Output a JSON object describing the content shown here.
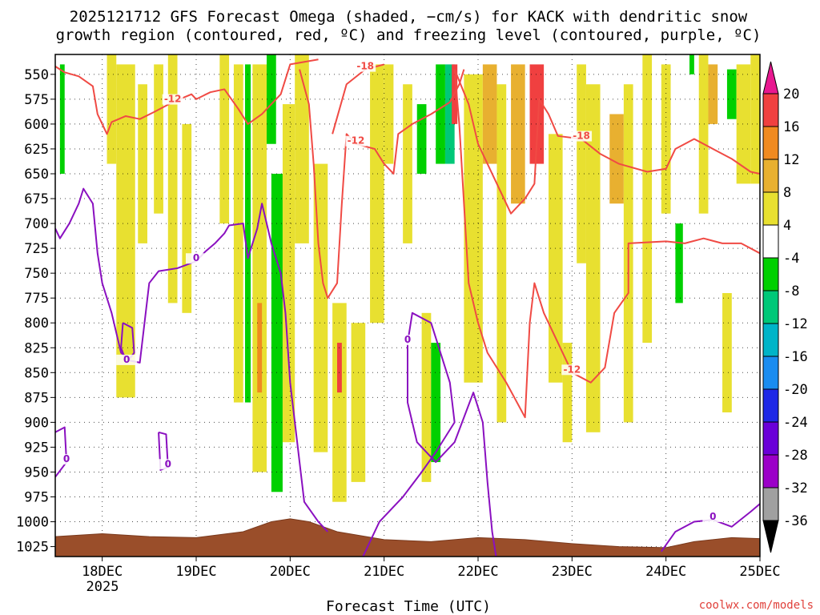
{
  "chart_data": {
    "type": "heatmap",
    "title_line1": "2025121712 GFS Forecast Omega (shaded, −cm/s) for KACK with dendritic snow",
    "title_line2": "growth region (contoured, red, ºC) and freezing level (contoured, purple, ºC)",
    "xlabel": "Forecast Time (UTC)",
    "ylabel": "",
    "credit": "coolwx.com/models",
    "x_ticks": [
      "18DEC",
      "19DEC",
      "20DEC",
      "21DEC",
      "22DEC",
      "23DEC",
      "24DEC",
      "25DEC"
    ],
    "x_year_label": "2025",
    "x_range": [
      -0.5,
      7.0
    ],
    "y_ticks": [
      550,
      575,
      600,
      625,
      650,
      675,
      700,
      725,
      750,
      775,
      800,
      825,
      850,
      875,
      900,
      925,
      950,
      975,
      1000,
      1025
    ],
    "y_range": [
      530,
      1035
    ],
    "colorbar": {
      "boundaries": [
        -36,
        -32,
        -28,
        -24,
        -20,
        -16,
        -12,
        -8,
        -4,
        4,
        8,
        12,
        16,
        20
      ],
      "colors": [
        "#000000",
        "#a0a0a0",
        "#9b00c8",
        "#6a00d8",
        "#1e28e6",
        "#1a8cf0",
        "#00b4c8",
        "#00c878",
        "#00d000",
        "#ffffff",
        "#e8e030",
        "#e8b030",
        "#f08a20",
        "#f04040",
        "#e81890"
      ]
    },
    "dgz_contours": [
      {
        "label": "-12",
        "points": [
          [
            -0.5,
            542
          ],
          [
            -0.4,
            548
          ],
          [
            -0.25,
            552
          ],
          [
            -0.1,
            562
          ],
          [
            -0.05,
            590
          ],
          [
            0.05,
            610
          ],
          [
            0.1,
            598
          ],
          [
            0.25,
            592
          ],
          [
            0.4,
            595
          ],
          [
            0.55,
            588
          ],
          [
            0.75,
            578
          ],
          [
            0.95,
            570
          ],
          [
            1.0,
            575
          ],
          [
            1.15,
            568
          ],
          [
            1.3,
            565
          ],
          [
            1.45,
            585
          ],
          [
            1.55,
            600
          ],
          [
            1.7,
            590
          ],
          [
            1.9,
            570
          ],
          [
            2.0,
            540
          ],
          [
            2.3,
            535
          ]
        ]
      },
      {
        "label": "-12",
        "points": [
          [
            2.1,
            545
          ],
          [
            2.2,
            580
          ],
          [
            2.25,
            640
          ],
          [
            2.3,
            720
          ],
          [
            2.35,
            760
          ],
          [
            2.4,
            775
          ],
          [
            2.5,
            760
          ],
          [
            2.55,
            680
          ],
          [
            2.6,
            610
          ],
          [
            2.7,
            620
          ],
          [
            2.9,
            625
          ],
          [
            3.0,
            640
          ],
          [
            3.1,
            650
          ],
          [
            3.15,
            610
          ],
          [
            3.3,
            600
          ],
          [
            3.5,
            590
          ],
          [
            3.7,
            578
          ],
          [
            3.8,
            560
          ],
          [
            3.85,
            545
          ]
        ]
      },
      {
        "label": "-12",
        "points": [
          [
            3.75,
            545
          ],
          [
            3.8,
            600
          ],
          [
            3.85,
            680
          ],
          [
            3.9,
            760
          ],
          [
            4.0,
            800
          ],
          [
            4.1,
            830
          ],
          [
            4.3,
            860
          ],
          [
            4.5,
            895
          ],
          [
            4.55,
            800
          ],
          [
            4.6,
            760
          ],
          [
            4.7,
            790
          ],
          [
            4.9,
            830
          ],
          [
            5.0,
            850
          ],
          [
            5.2,
            860
          ],
          [
            5.35,
            845
          ],
          [
            5.45,
            790
          ],
          [
            5.6,
            770
          ],
          [
            5.6,
            720
          ],
          [
            6.0,
            718
          ],
          [
            6.2,
            720
          ],
          [
            6.4,
            715
          ],
          [
            6.6,
            720
          ],
          [
            6.8,
            720
          ],
          [
            7.0,
            730
          ]
        ]
      },
      {
        "label": "-18",
        "points": [
          [
            3.75,
            545
          ],
          [
            3.9,
            580
          ],
          [
            4.0,
            620
          ],
          [
            4.2,
            660
          ],
          [
            4.35,
            690
          ],
          [
            4.5,
            675
          ],
          [
            4.6,
            660
          ],
          [
            4.65,
            575
          ],
          [
            4.75,
            590
          ],
          [
            4.85,
            612
          ],
          [
            5.1,
            615
          ],
          [
            5.3,
            630
          ],
          [
            5.5,
            640
          ],
          [
            5.8,
            648
          ],
          [
            6.0,
            645
          ],
          [
            6.1,
            625
          ],
          [
            6.3,
            615
          ],
          [
            6.5,
            625
          ],
          [
            6.7,
            635
          ],
          [
            6.9,
            648
          ],
          [
            7.0,
            650
          ]
        ]
      },
      {
        "label": "-18",
        "points": [
          [
            2.45,
            610
          ],
          [
            2.6,
            560
          ],
          [
            2.8,
            545
          ],
          [
            3.0,
            540
          ]
        ]
      }
    ],
    "freezing_contours": [
      {
        "label": "0",
        "points": [
          [
            -0.5,
            705
          ],
          [
            -0.45,
            715
          ],
          [
            -0.35,
            700
          ],
          [
            -0.25,
            680
          ],
          [
            -0.2,
            665
          ],
          [
            -0.1,
            680
          ],
          [
            -0.05,
            730
          ],
          [
            0.0,
            760
          ],
          [
            0.1,
            790
          ],
          [
            0.2,
            830
          ],
          [
            0.3,
            838
          ],
          [
            0.4,
            840
          ],
          [
            0.45,
            800
          ],
          [
            0.5,
            760
          ],
          [
            0.6,
            748
          ],
          [
            0.8,
            745
          ],
          [
            1.0,
            738
          ],
          [
            1.1,
            728
          ],
          [
            1.2,
            720
          ],
          [
            1.3,
            710
          ],
          [
            1.35,
            702
          ],
          [
            1.5,
            700
          ],
          [
            1.55,
            735
          ],
          [
            1.65,
            705
          ],
          [
            1.7,
            680
          ],
          [
            1.8,
            720
          ],
          [
            1.9,
            750
          ],
          [
            1.95,
            790
          ],
          [
            2.0,
            860
          ],
          [
            2.1,
            940
          ],
          [
            2.15,
            980
          ],
          [
            2.3,
            1000
          ],
          [
            2.4,
            1010
          ]
        ]
      },
      {
        "label": "0",
        "points": [
          [
            2.75,
            1040
          ],
          [
            2.95,
            1000
          ],
          [
            3.2,
            975
          ],
          [
            3.4,
            950
          ],
          [
            3.55,
            930
          ],
          [
            3.75,
            900
          ],
          [
            3.7,
            860
          ],
          [
            3.5,
            800
          ],
          [
            3.3,
            790
          ],
          [
            3.25,
            820
          ],
          [
            3.25,
            880
          ],
          [
            3.35,
            920
          ],
          [
            3.55,
            940
          ],
          [
            3.75,
            920
          ],
          [
            3.95,
            870
          ],
          [
            4.05,
            900
          ],
          [
            4.1,
            960
          ],
          [
            4.15,
            1010
          ],
          [
            4.2,
            1040
          ]
        ]
      },
      {
        "label": "0",
        "points": [
          [
            -0.5,
            910
          ],
          [
            -0.4,
            905
          ],
          [
            -0.38,
            940
          ],
          [
            -0.5,
            955
          ]
        ]
      },
      {
        "label": "0",
        "points": [
          [
            0.22,
            800
          ],
          [
            0.32,
            805
          ],
          [
            0.34,
            830
          ],
          [
            0.26,
            840
          ],
          [
            0.2,
            825
          ],
          [
            0.22,
            800
          ]
        ]
      },
      {
        "label": "0",
        "points": [
          [
            0.6,
            910
          ],
          [
            0.68,
            912
          ],
          [
            0.7,
            945
          ],
          [
            0.62,
            948
          ],
          [
            0.6,
            910
          ]
        ]
      },
      {
        "label": "0",
        "points": [
          [
            5.95,
            1030
          ],
          [
            6.1,
            1010
          ],
          [
            6.3,
            1000
          ],
          [
            6.5,
            998
          ],
          [
            6.7,
            1005
          ],
          [
            6.9,
            990
          ],
          [
            7.0,
            982
          ]
        ]
      }
    ],
    "omega_cells": [
      {
        "x": [
          -0.45,
          -0.4
        ],
        "p": [
          540,
          650
        ],
        "value": -6
      },
      {
        "x": [
          0.05,
          0.15
        ],
        "p": [
          530,
          640
        ],
        "value": 5
      },
      {
        "x": [
          0.15,
          0.35
        ],
        "p": [
          540,
          875
        ],
        "value": 6
      },
      {
        "x": [
          0.38,
          0.48
        ],
        "p": [
          560,
          720
        ],
        "value": 5
      },
      {
        "x": [
          0.55,
          0.65
        ],
        "p": [
          540,
          690
        ],
        "value": 5
      },
      {
        "x": [
          0.7,
          0.8
        ],
        "p": [
          530,
          780
        ],
        "value": 6
      },
      {
        "x": [
          0.85,
          0.95
        ],
        "p": [
          600,
          790
        ],
        "value": 5
      },
      {
        "x": [
          1.25,
          1.35
        ],
        "p": [
          530,
          700
        ],
        "value": 5
      },
      {
        "x": [
          1.4,
          1.5
        ],
        "p": [
          540,
          880
        ],
        "value": 6
      },
      {
        "x": [
          1.52,
          1.58
        ],
        "p": [
          540,
          880
        ],
        "value": -6
      },
      {
        "x": [
          1.6,
          1.75
        ],
        "p": [
          540,
          950
        ],
        "value": 7
      },
      {
        "x": [
          1.65,
          1.7
        ],
        "p": [
          780,
          870
        ],
        "value": 13
      },
      {
        "x": [
          1.75,
          1.85
        ],
        "p": [
          530,
          620
        ],
        "value": -6
      },
      {
        "x": [
          1.8,
          1.92
        ],
        "p": [
          650,
          970
        ],
        "value": -6
      },
      {
        "x": [
          1.92,
          2.05
        ],
        "p": [
          580,
          920
        ],
        "value": 6
      },
      {
        "x": [
          2.05,
          2.2
        ],
        "p": [
          530,
          720
        ],
        "value": 5
      },
      {
        "x": [
          2.25,
          2.4
        ],
        "p": [
          640,
          930
        ],
        "value": 6
      },
      {
        "x": [
          2.45,
          2.6
        ],
        "p": [
          780,
          980
        ],
        "value": 7
      },
      {
        "x": [
          2.5,
          2.55
        ],
        "p": [
          820,
          870
        ],
        "value": 17
      },
      {
        "x": [
          2.65,
          2.8
        ],
        "p": [
          800,
          960
        ],
        "value": 5
      },
      {
        "x": [
          2.85,
          3.0
        ],
        "p": [
          540,
          800
        ],
        "value": 5
      },
      {
        "x": [
          3.0,
          3.1
        ],
        "p": [
          540,
          640
        ],
        "value": 5
      },
      {
        "x": [
          3.2,
          3.3
        ],
        "p": [
          560,
          720
        ],
        "value": 5
      },
      {
        "x": [
          3.35,
          3.45
        ],
        "p": [
          580,
          650
        ],
        "value": -6
      },
      {
        "x": [
          3.4,
          3.5
        ],
        "p": [
          790,
          960
        ],
        "value": 5
      },
      {
        "x": [
          3.5,
          3.6
        ],
        "p": [
          820,
          940
        ],
        "value": -6
      },
      {
        "x": [
          3.55,
          3.65
        ],
        "p": [
          540,
          640
        ],
        "value": -6
      },
      {
        "x": [
          3.65,
          3.75
        ],
        "p": [
          540,
          640
        ],
        "value": -10
      },
      {
        "x": [
          3.72,
          3.78
        ],
        "p": [
          540,
          600
        ],
        "value": 17
      },
      {
        "x": [
          3.85,
          4.05
        ],
        "p": [
          550,
          860
        ],
        "value": 5
      },
      {
        "x": [
          4.05,
          4.2
        ],
        "p": [
          540,
          640
        ],
        "value": 9
      },
      {
        "x": [
          4.2,
          4.3
        ],
        "p": [
          560,
          900
        ],
        "value": 5
      },
      {
        "x": [
          4.35,
          4.5
        ],
        "p": [
          540,
          680
        ],
        "value": 9
      },
      {
        "x": [
          4.55,
          4.7
        ],
        "p": [
          540,
          640
        ],
        "value": 17
      },
      {
        "x": [
          4.75,
          4.9
        ],
        "p": [
          610,
          860
        ],
        "value": 5
      },
      {
        "x": [
          4.9,
          5.0
        ],
        "p": [
          820,
          920
        ],
        "value": 5
      },
      {
        "x": [
          5.05,
          5.15
        ],
        "p": [
          540,
          740
        ],
        "value": 5
      },
      {
        "x": [
          5.15,
          5.3
        ],
        "p": [
          560,
          910
        ],
        "value": 5
      },
      {
        "x": [
          5.4,
          5.55
        ],
        "p": [
          590,
          680
        ],
        "value": 9
      },
      {
        "x": [
          5.55,
          5.65
        ],
        "p": [
          560,
          900
        ],
        "value": 5
      },
      {
        "x": [
          5.75,
          5.85
        ],
        "p": [
          530,
          820
        ],
        "value": 5
      },
      {
        "x": [
          5.95,
          6.05
        ],
        "p": [
          540,
          690
        ],
        "value": 5
      },
      {
        "x": [
          6.1,
          6.18
        ],
        "p": [
          700,
          780
        ],
        "value": -6
      },
      {
        "x": [
          6.25,
          6.3
        ],
        "p": [
          530,
          550
        ],
        "value": -6
      },
      {
        "x": [
          6.35,
          6.45
        ],
        "p": [
          530,
          690
        ],
        "value": 5
      },
      {
        "x": [
          6.45,
          6.55
        ],
        "p": [
          540,
          600
        ],
        "value": 9
      },
      {
        "x": [
          6.6,
          6.7
        ],
        "p": [
          770,
          890
        ],
        "value": 5
      },
      {
        "x": [
          6.65,
          6.75
        ],
        "p": [
          545,
          595
        ],
        "value": -6
      },
      {
        "x": [
          6.75,
          6.9
        ],
        "p": [
          540,
          660
        ],
        "value": 5
      },
      {
        "x": [
          6.9,
          7.0
        ],
        "p": [
          530,
          660
        ],
        "value": 5
      }
    ],
    "terrain_pressure": [
      [
        -0.5,
        1015
      ],
      [
        0.0,
        1012
      ],
      [
        0.5,
        1015
      ],
      [
        1.0,
        1016
      ],
      [
        1.5,
        1010
      ],
      [
        1.8,
        1000
      ],
      [
        2.0,
        997
      ],
      [
        2.2,
        1000
      ],
      [
        2.5,
        1010
      ],
      [
        3.0,
        1018
      ],
      [
        3.5,
        1020
      ],
      [
        4.0,
        1016
      ],
      [
        4.5,
        1018
      ],
      [
        5.0,
        1022
      ],
      [
        5.5,
        1025
      ],
      [
        6.0,
        1026
      ],
      [
        6.3,
        1020
      ],
      [
        6.7,
        1016
      ],
      [
        7.0,
        1017
      ]
    ]
  }
}
